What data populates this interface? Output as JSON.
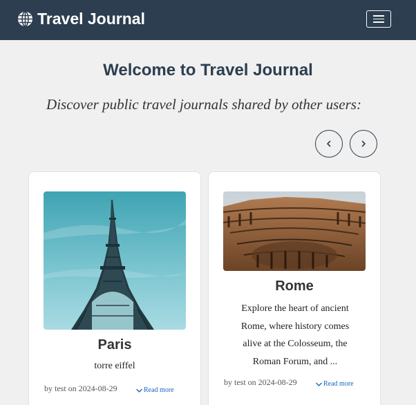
{
  "navbar": {
    "brand": "Travel Journal",
    "brand_icon": "globe-icon",
    "menu_icon": "hamburger-menu-icon"
  },
  "main": {
    "title": "Welcome to Travel Journal",
    "subtitle": "Discover public travel journals shared by other users:"
  },
  "carousel": {
    "prev_icon": "chevron-left-icon",
    "next_icon": "chevron-right-icon"
  },
  "cards": [
    {
      "title": "Paris",
      "description": "torre eiffel",
      "meta": "by test on 2024-08-29",
      "read_more": "Read more",
      "image": "eiffel-tower-photo"
    },
    {
      "title": "Rome",
      "description": "Explore the heart of ancient Rome, where history comes alive at the Colosseum, the Roman Forum, and ...",
      "meta": "by test on 2024-08-29",
      "read_more": "Read more",
      "image": "colosseum-photo"
    }
  ],
  "colors": {
    "navbar_bg": "#2c3e50",
    "page_bg": "#f0f0f0",
    "link": "#1565c0"
  }
}
